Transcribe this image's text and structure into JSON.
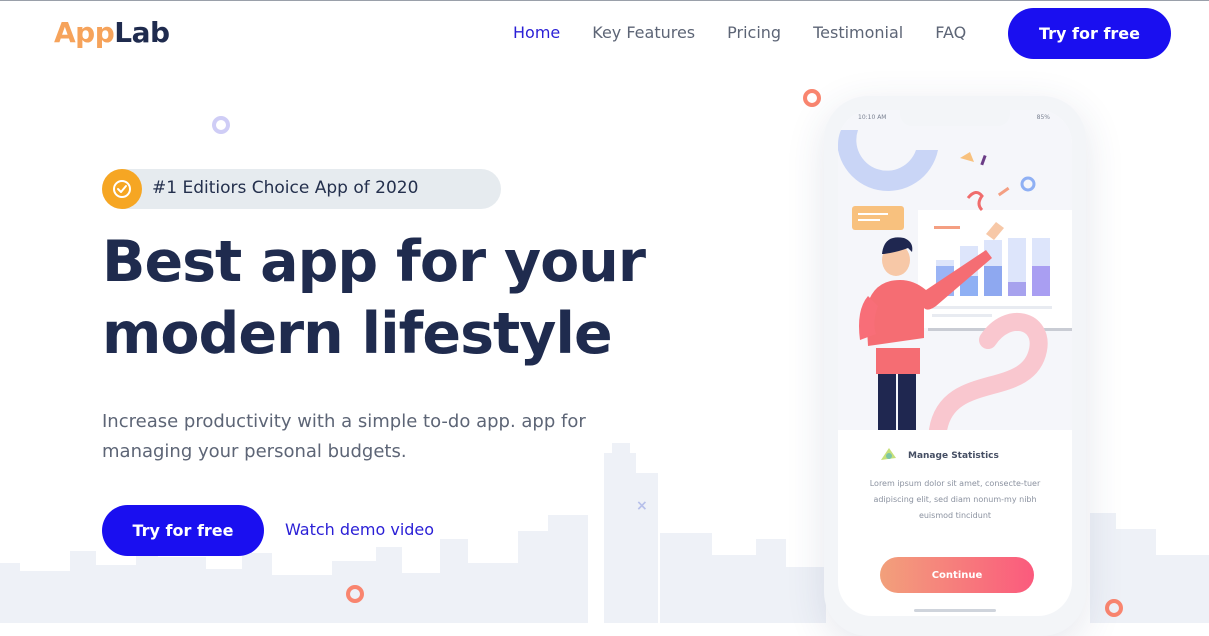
{
  "brand": {
    "part1": "App",
    "part2": "Lab",
    "color1": "#f6a35b",
    "color2": "#1f2b4e"
  },
  "nav": {
    "items": [
      {
        "label": "Home",
        "active": true
      },
      {
        "label": "Key Features",
        "active": false
      },
      {
        "label": "Pricing",
        "active": false
      },
      {
        "label": "Testimonial",
        "active": false
      },
      {
        "label": "FAQ",
        "active": false
      }
    ],
    "cta_label": "Try for free"
  },
  "hero": {
    "badge_text": "#1 Editiors Choice App of 2020",
    "title_line1": "Best app for your",
    "title_line2": "modern lifestyle",
    "description": "Increase productivity with a simple to-do app. app for managing your personal budgets.",
    "cta_label": "Try for free",
    "demo_link": "Watch demo video"
  },
  "phone": {
    "status_time": "10:10 AM",
    "status_battery": "85%",
    "card_title": "Manage Statistics",
    "card_desc": "Lorem ipsum dolor sit amet, consecte-tuer adipiscing elit, sed diam nonum-my nibh euismod tincidunt",
    "continue_label": "Continue"
  },
  "colors": {
    "accent": "#1a0ff0",
    "badge_icon": "#f6a623",
    "text_dark": "#1f2b4e",
    "text_muted": "#5d6576",
    "button_gradient_start": "#f2a07b",
    "button_gradient_end": "#fb5a7d"
  },
  "icons": [
    "check-badge-icon",
    "decor-ring-icon",
    "stats-icon"
  ]
}
